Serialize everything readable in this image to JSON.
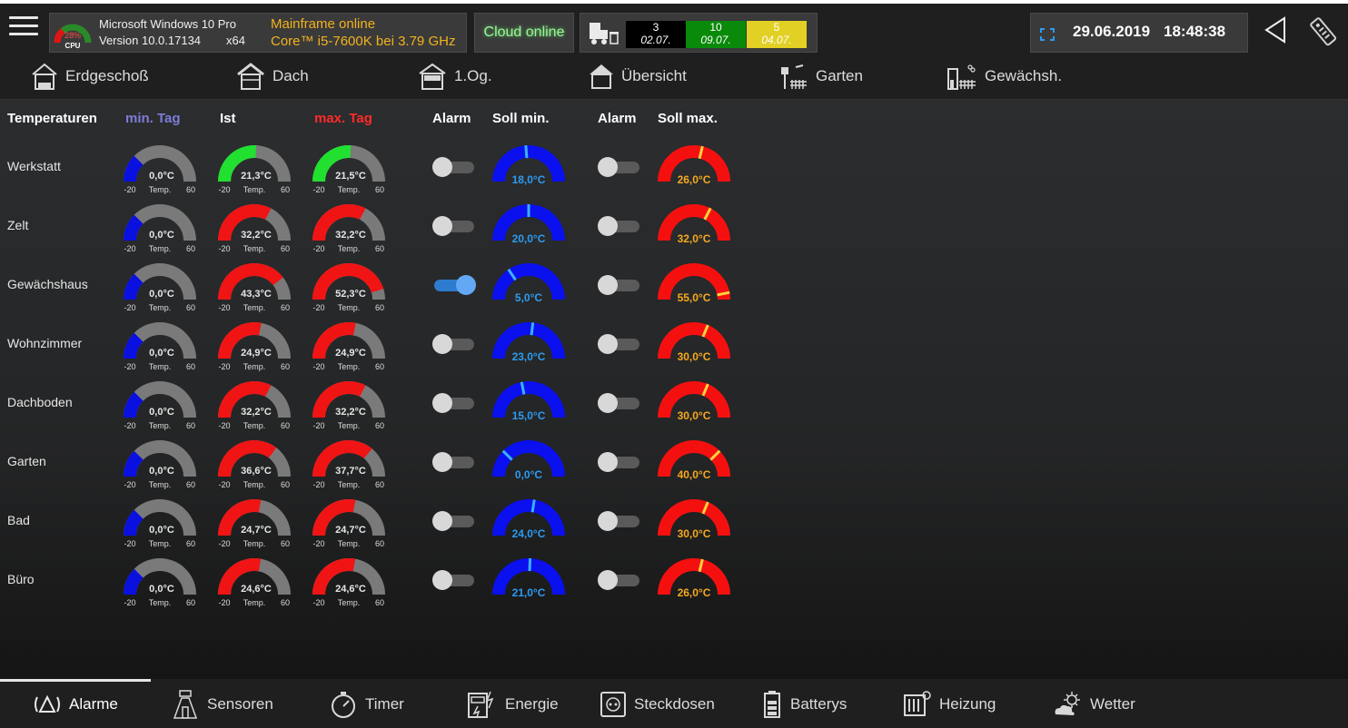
{
  "top": {
    "cpu_percent": "28%",
    "cpu_label": "CPU",
    "cpu_value": 0.28,
    "os_name": "Microsoft Windows 10 Pro",
    "os_version": "Version 10.0.17134",
    "os_arch": "x64",
    "mainframe_status": "Mainframe online",
    "cpu_model": "Core™ i5-7600K bei  3.79 GHz",
    "cloud_status": "Cloud online",
    "trash": [
      {
        "count": "3",
        "date": "02.07."
      },
      {
        "count": "10",
        "date": "09.07."
      },
      {
        "count": "5",
        "date": "04.07."
      }
    ],
    "date": "29.06.2019",
    "time": "18:48:38"
  },
  "nav": [
    {
      "label": "Erdgeschoß",
      "icon": "house-ground-icon"
    },
    {
      "label": "Dach",
      "icon": "house-roof-icon"
    },
    {
      "label": "1.Og.",
      "icon": "house-floor-icon"
    },
    {
      "label": "Übersicht",
      "icon": "house-overview-icon"
    },
    {
      "label": "Garten",
      "icon": "garden-icon"
    },
    {
      "label": "Gewächsh.",
      "icon": "greenhouse-icon"
    }
  ],
  "table": {
    "headers": {
      "rooms": "Temperaturen",
      "min": "min. Tag",
      "ist": "Ist",
      "max": "max. Tag",
      "alarm1": "Alarm",
      "soll_min": "Soll min.",
      "alarm2": "Alarm",
      "soll_max": "Soll max."
    },
    "gauge_min": "-20",
    "gauge_max": "60",
    "gauge_unit": "Temp.",
    "rows": [
      {
        "name": "Werkstatt",
        "min": "0,0°C",
        "ist": "21,3°C",
        "max": "21,5°C",
        "alarm_min": false,
        "soll_min": "18,0°C",
        "alarm_max": false,
        "soll_max": "26,0°C"
      },
      {
        "name": "Zelt",
        "min": "0,0°C",
        "ist": "32,2°C",
        "max": "32,2°C",
        "alarm_min": false,
        "soll_min": "20,0°C",
        "alarm_max": false,
        "soll_max": "32,0°C"
      },
      {
        "name": "Gewächshaus",
        "min": "0,0°C",
        "ist": "43,3°C",
        "max": "52,3°C",
        "alarm_min": true,
        "soll_min": "5,0°C",
        "alarm_max": false,
        "soll_max": "55,0°C"
      },
      {
        "name": "Wohnzimmer",
        "min": "0,0°C",
        "ist": "24,9°C",
        "max": "24,9°C",
        "alarm_min": false,
        "soll_min": "23,0°C",
        "alarm_max": false,
        "soll_max": "30,0°C"
      },
      {
        "name": "Dachboden",
        "min": "0,0°C",
        "ist": "32,2°C",
        "max": "32,2°C",
        "alarm_min": false,
        "soll_min": "15,0°C",
        "alarm_max": false,
        "soll_max": "30,0°C"
      },
      {
        "name": "Garten",
        "min": "0,0°C",
        "ist": "36,6°C",
        "max": "37,7°C",
        "alarm_min": false,
        "soll_min": "0,0°C",
        "alarm_max": false,
        "soll_max": "40,0°C"
      },
      {
        "name": "Bad",
        "min": "0,0°C",
        "ist": "24,7°C",
        "max": "24,7°C",
        "alarm_min": false,
        "soll_min": "24,0°C",
        "alarm_max": false,
        "soll_max": "30,0°C"
      },
      {
        "name": "Büro",
        "min": "0,0°C",
        "ist": "24,6°C",
        "max": "24,6°C",
        "alarm_min": false,
        "soll_min": "21,0°C",
        "alarm_max": false,
        "soll_max": "26,0°C"
      }
    ]
  },
  "tabs": [
    {
      "label": "Alarme",
      "icon": "alarm-icon"
    },
    {
      "label": "Sensoren",
      "icon": "sensor-icon"
    },
    {
      "label": "Timer",
      "icon": "timer-icon"
    },
    {
      "label": "Energie",
      "icon": "energy-icon"
    },
    {
      "label": "Steckdosen",
      "icon": "socket-icon"
    },
    {
      "label": "Batterys",
      "icon": "battery-icon"
    },
    {
      "label": "Heizung",
      "icon": "heating-icon"
    },
    {
      "label": "Wetter",
      "icon": "weather-icon"
    }
  ],
  "colors": {
    "gauge_bg": "#7a7a7a",
    "min_fill": "#0a10e0",
    "ist_hot": "#f01414",
    "ist_ok": "#22e030",
    "soll_min_fill": "#0a10ee",
    "soll_min_text": "#2e9bf0",
    "soll_max_fill": "#f51010",
    "soll_max_text": "#f6a81e",
    "accent_yellow": "#f2b21e"
  }
}
